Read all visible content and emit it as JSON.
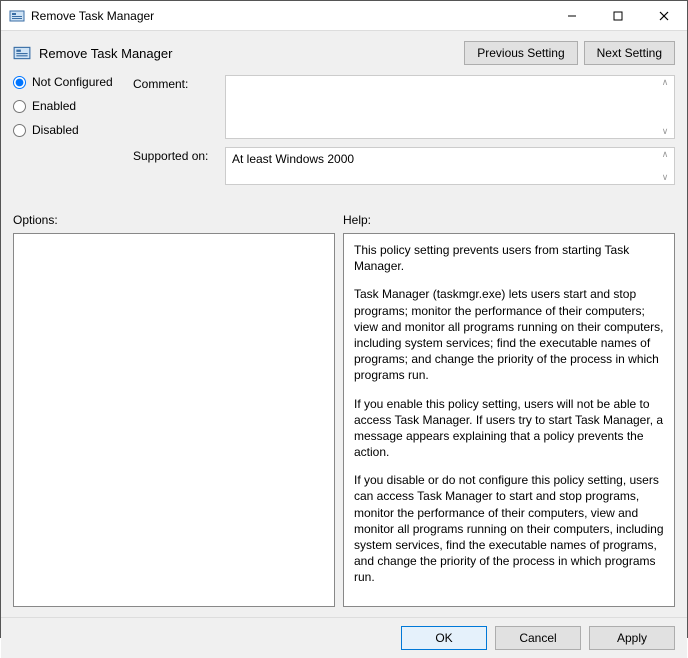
{
  "window": {
    "title": "Remove Task Manager"
  },
  "header": {
    "policy_title": "Remove Task Manager",
    "prev_label": "Previous Setting",
    "next_label": "Next Setting"
  },
  "state": {
    "options": [
      {
        "value": "not_configured",
        "label": "Not Configured"
      },
      {
        "value": "enabled",
        "label": "Enabled"
      },
      {
        "value": "disabled",
        "label": "Disabled"
      }
    ],
    "selected": "not_configured",
    "comment_label": "Comment:",
    "comment_value": "",
    "supported_label": "Supported on:",
    "supported_value": "At least Windows 2000"
  },
  "labels": {
    "options": "Options:",
    "help": "Help:"
  },
  "help": {
    "p1": "This policy setting prevents users from starting Task Manager.",
    "p2": "Task Manager (taskmgr.exe) lets users start and stop programs; monitor the performance of their computers; view and monitor all programs running on their computers, including system services; find the executable names of programs; and change the priority of the process in which programs run.",
    "p3": "If you enable this policy setting, users will not be able to access Task Manager. If users try to start Task Manager, a message appears explaining that a policy prevents the action.",
    "p4": "If you disable or do not configure this policy setting, users can access Task Manager to  start and stop programs, monitor the performance of their computers, view and monitor all programs running on their computers, including system services, find the executable names of programs, and change the priority of the process in which programs run."
  },
  "buttons": {
    "ok": "OK",
    "cancel": "Cancel",
    "apply": "Apply"
  }
}
